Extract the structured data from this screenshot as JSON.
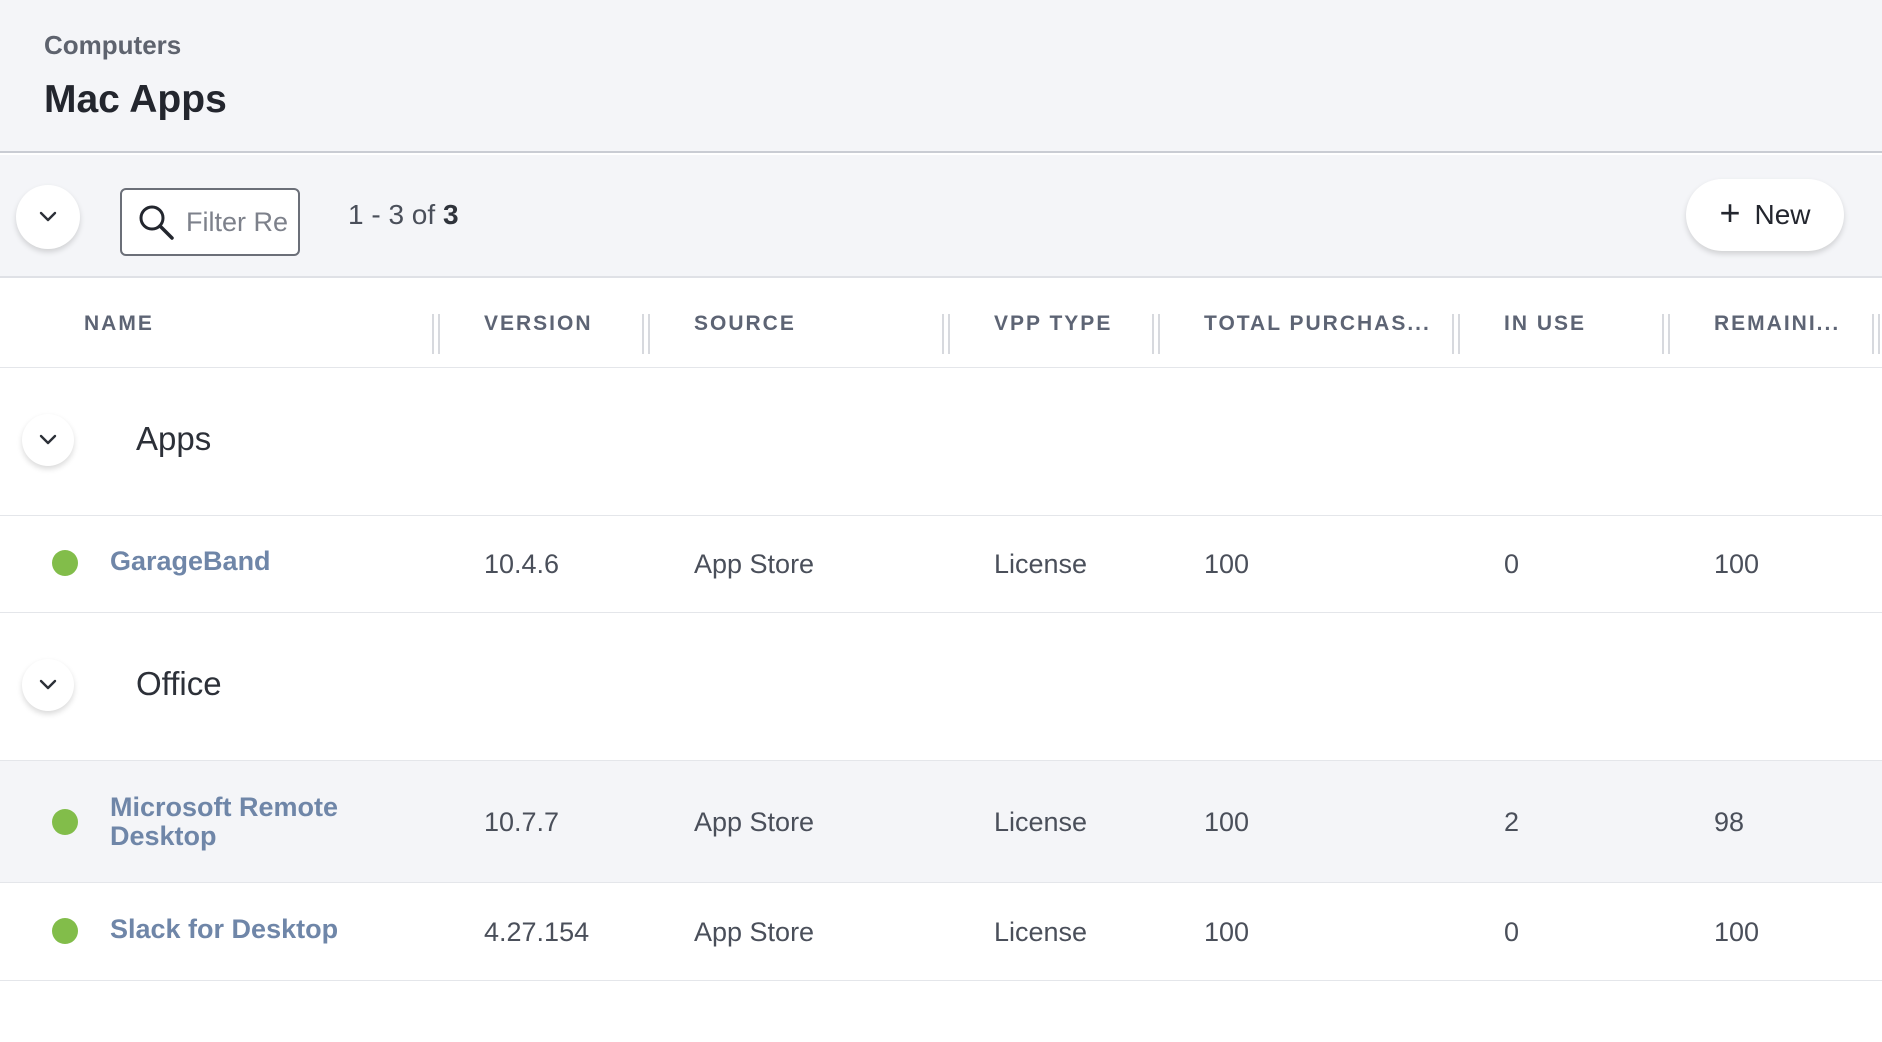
{
  "header": {
    "breadcrumb": "Computers",
    "title": "Mac Apps"
  },
  "toolbar": {
    "search_placeholder": "Filter Re",
    "pager_range": "1 - 3 of ",
    "pager_total": "3",
    "new_label": "New"
  },
  "columns": [
    "NAME",
    "VERSION",
    "SOURCE",
    "VPP TYPE",
    "TOTAL PURCHAS...",
    "IN USE",
    "REMAINI..."
  ],
  "groups": [
    {
      "label": "Apps",
      "rows": [
        {
          "name": "GarageBand",
          "version": "10.4.6",
          "source": "App Store",
          "vpp_type": "License",
          "total_purchased": "100",
          "in_use": "0",
          "remaining": "100",
          "status": "green"
        }
      ]
    },
    {
      "label": "Office",
      "rows": [
        {
          "name": "Microsoft Remote Desktop",
          "version": "10.7.7",
          "source": "App Store",
          "vpp_type": "License",
          "total_purchased": "100",
          "in_use": "2",
          "remaining": "98",
          "status": "green"
        },
        {
          "name": "Slack for Desktop",
          "version": "4.27.154",
          "source": "App Store",
          "vpp_type": "License",
          "total_purchased": "100",
          "in_use": "0",
          "remaining": "100",
          "status": "green"
        }
      ]
    }
  ],
  "colors": {
    "status_green": "#82bd4a",
    "link": "#6f86a8",
    "header_bg": "#f4f5f8"
  },
  "icons": {
    "toolbar_toggle": "chevron-down-icon",
    "search": "search-icon",
    "new": "plus-icon",
    "group_toggle": "chevron-down-icon",
    "status": "status-dot-icon"
  }
}
